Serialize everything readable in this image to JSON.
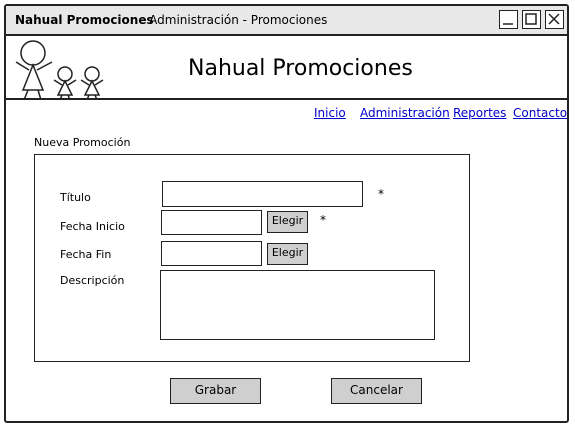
{
  "window": {
    "app_name": "Nahual Promociones",
    "subtitle": "- Administración - Promociones",
    "buttons": [
      "minimize",
      "maximize",
      "close"
    ]
  },
  "header": {
    "title": "Nahual Promociones",
    "logo_icon": "family-logo-icon"
  },
  "nav": {
    "items": [
      "Inicio",
      "Administración",
      "Reportes",
      "Contacto"
    ]
  },
  "form": {
    "section_label": "Nueva Promoción",
    "titulo_label": "Título",
    "titulo_value": "",
    "fecha_inicio_label": "Fecha Inicio",
    "fecha_inicio_value": "",
    "fecha_fin_label": "Fecha Fin",
    "fecha_fin_value": "",
    "descripcion_label": "Descripción",
    "descripcion_value": "",
    "elegir_label": "Elegir",
    "required_mark": "*",
    "save_label": "Grabar",
    "cancel_label": "Cancelar"
  }
}
